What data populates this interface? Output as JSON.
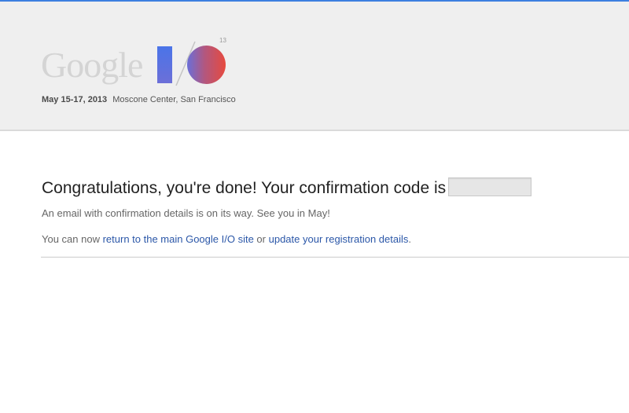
{
  "header": {
    "logo": {
      "word": "Google",
      "io_text": "I/O",
      "superscript": "13",
      "i_color": "#4a74e8",
      "o_color_start": "#6a6fd8",
      "o_color_end": "#e74a3e"
    },
    "dates": "May 15-17, 2013",
    "location": "Moscone Center, San Francisco"
  },
  "content": {
    "heading": "Congratulations, you're done! Your confirmation code is",
    "confirmation_code": "",
    "email_notice": "An email with confirmation details is on its way. See you in May!",
    "next_steps": {
      "prefix": "You can now ",
      "link_main_site": "return to the main Google I/O site",
      "middle": " or ",
      "link_update": "update your registration details",
      "suffix": "."
    }
  },
  "colors": {
    "accent_bar": "#3d7fe0",
    "link": "#2b57a8",
    "header_bg": "#efefef"
  }
}
